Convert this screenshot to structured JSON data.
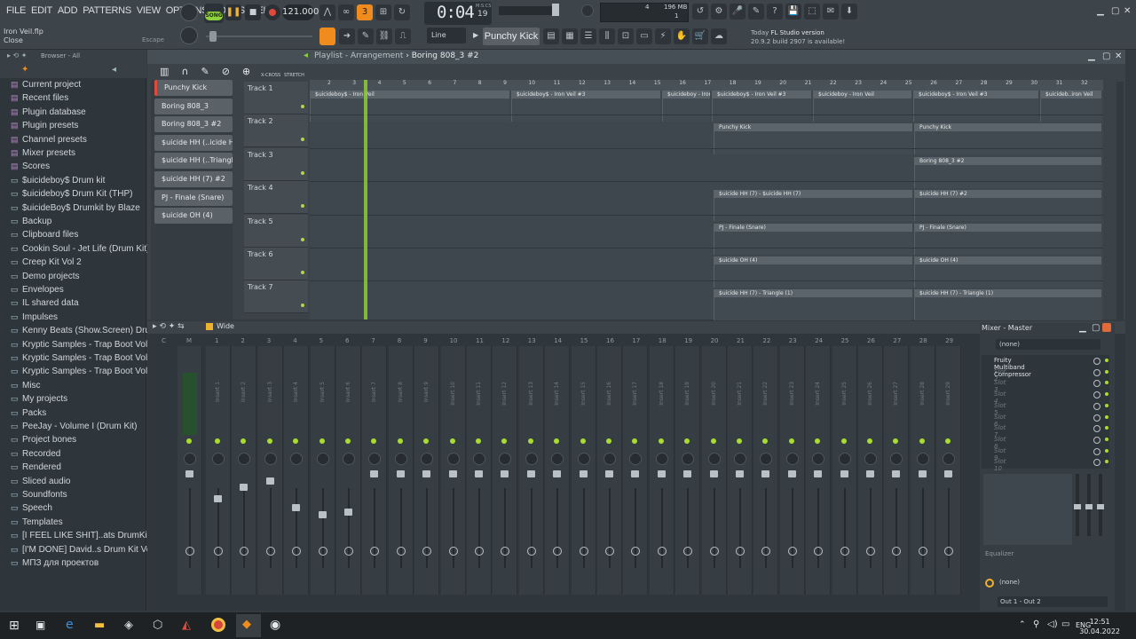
{
  "menu": [
    "FILE",
    "EDIT",
    "ADD",
    "PATTERNS",
    "VIEW",
    "OPTIONS",
    "TOOLS",
    "HELP"
  ],
  "transport": {
    "song_label": "SONG",
    "tempo": "121.000",
    "time": "0:04",
    "time_sub": "19",
    "time_caption": "M:S:CS"
  },
  "monitor": {
    "ram": "196 MB",
    "cpu_num": "4",
    "poly": "1"
  },
  "project": {
    "title": "Iron Veil.flp",
    "close_label": "Close",
    "escape_label": "Escape"
  },
  "news": {
    "today": "Today",
    "headline": "FL Studio version",
    "detail": "20.9.2 build 2907 is available!"
  },
  "toolbar": {
    "line_mode": "Line",
    "channel": "Punchy Kick"
  },
  "browser": {
    "title": "Browser - All",
    "items": [
      "Current project",
      "Recent files",
      "Plugin database",
      "Plugin presets",
      "Channel presets",
      "Mixer presets",
      "Scores",
      "$uicideboy$ Drum kit",
      "$uicideboy$ Drum Kit (THP)",
      "$uicideBoy$ Drumkit by Blaze",
      "Backup",
      "Clipboard files",
      "Cookin Soul - Jet Life (Drum Kit)",
      "Creep Kit Vol 2",
      "Demo projects",
      "Envelopes",
      "IL shared data",
      "Impulses",
      "Kenny Beats (Show.Screen) Drumkit",
      "Kryptic Samples - Trap Boot Vol. 1",
      "Kryptic Samples - Trap Boot Vol. 2",
      "Kryptic Samples - Trap Boot Vol. 3",
      "Misc",
      "My projects",
      "Packs",
      "PeeJay - Volume I (Drum Kit)",
      "Project bones",
      "Recorded",
      "Rendered",
      "Sliced audio",
      "Soundfonts",
      "Speech",
      "Templates",
      "[I FEEL LIKE SHIT]..ats DrumKit Vol.1",
      "[I'M DONE] David..s Drum Kit Vol. 2",
      "МПЗ для проектов"
    ]
  },
  "playlist": {
    "title_prefix": "Playlist - Arrangement",
    "pattern": "Boring 808_3 #2",
    "picker": [
      "Punchy Kick",
      "Boring 808_3",
      "Boring 808_3 #2",
      "$uicide HH (..icide HH (7)",
      "$uicide HH (..Triangle (1)",
      "$uicide HH (7) #2",
      "PJ - Finale (Snare)",
      "$uicide OH (4)"
    ],
    "tracks": [
      "Track 1",
      "Track 2",
      "Track 3",
      "Track 4",
      "Track 5",
      "Track 6",
      "Track 7"
    ],
    "ruler": [
      "2",
      "3",
      "4",
      "5",
      "6",
      "7",
      "8",
      "9",
      "10",
      "11",
      "12",
      "13",
      "14",
      "15",
      "16",
      "17",
      "18",
      "19",
      "20",
      "21",
      "22",
      "23",
      "24",
      "25",
      "26",
      "27",
      "28",
      "29",
      "30",
      "31",
      "32"
    ],
    "clips": [
      {
        "row": 0,
        "labels": [
          "$uicideboy$ - Iron Veil",
          "$uicideboy$ - Iron Veil #3",
          "$uicideboy - Iron Veil #3",
          "$uicideboy$ - Iron Veil #3",
          "$uicideboy - Iron Veil",
          "$uicideboy$ - Iron Veil #3",
          "$uicideb..iron Veil"
        ]
      },
      {
        "row": 1,
        "labels": [
          "Punchy Kick",
          "Punchy Kick"
        ]
      },
      {
        "row": 2,
        "labels": [
          "Boring 808_3 #2"
        ]
      },
      {
        "row": 3,
        "labels": [
          "$uicide HH (7) - $uicide HH (7)",
          "$uicide HH (7) #2"
        ]
      },
      {
        "row": 4,
        "labels": [
          "PJ - Finale (Snare)",
          "PJ - Finale (Snare)"
        ]
      },
      {
        "row": 5,
        "labels": [
          "$uicide OH (4)",
          "$uicide OH (4)"
        ]
      },
      {
        "row": 6,
        "labels": [
          "$uicide HH (7) - Triangle (1)",
          "$uicide HH (7) - Triangle (1)"
        ]
      }
    ],
    "snap_labels": {
      "xcross": "X-CROSS",
      "stretch": "STRETCH"
    }
  },
  "mixer": {
    "view": "Wide",
    "master_label": "Master",
    "strip_head": [
      "C",
      "M",
      "1",
      "2",
      "3",
      "4",
      "5",
      "6",
      "7",
      "8",
      "9",
      "10",
      "11",
      "12",
      "13",
      "14",
      "15",
      "16",
      "17",
      "18",
      "19",
      "20",
      "21",
      "22",
      "23",
      "24",
      "25",
      "26",
      "27",
      "28",
      "29"
    ],
    "inserts": [
      "Insert 1",
      "Insert 2",
      "Insert 3",
      "Insert 4",
      "Insert 5",
      "Insert 6",
      "Insert 7",
      "Insert 8",
      "Insert 9",
      "Insert 10",
      "Insert 11",
      "Insert 12",
      "Insert 13",
      "Insert 14",
      "Insert 15",
      "Insert 16",
      "Insert 17",
      "Insert 18",
      "Insert 19",
      "Insert 20",
      "Insert 21",
      "Insert 22",
      "Insert 23",
      "Insert 24",
      "Insert 25",
      "Insert 26",
      "Insert 27",
      "Insert 28",
      "Insert 29"
    ],
    "panel_title": "Mixer - Master",
    "input": "(none)",
    "slots": [
      "Fruity Multiband Compressor",
      "Slot 2",
      "Slot 3",
      "Slot 4",
      "Slot 5",
      "Slot 6",
      "Slot 7",
      "Slot 8",
      "Slot 9",
      "Slot 10"
    ],
    "eq_label": "Equalizer",
    "output_none": "(none)",
    "output": "Out 1 - Out 2"
  },
  "taskbar": {
    "lang": "ENG",
    "time": "12:51",
    "date": "30.04.2022"
  },
  "colors": {
    "accent": "#8ed13d",
    "orange": "#f08c1e",
    "bg": "#343b40"
  }
}
